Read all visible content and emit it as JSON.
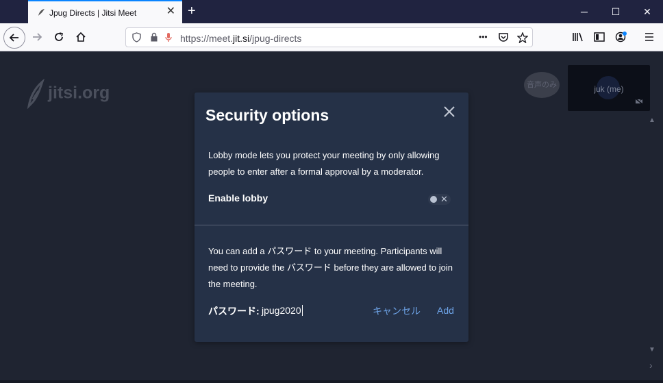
{
  "browser": {
    "tab_title": "Jpug Directs | Jitsi Meet",
    "url_prefix": "https://meet.",
    "url_host": "jit.si",
    "url_path": "/jpug-directs",
    "url_more": "•••"
  },
  "page": {
    "logo_text": "jitsi.org",
    "audio_only_label": "音声のみ",
    "thumbnail_name": "juk (me)"
  },
  "dialog": {
    "title": "Security options",
    "lobby_description": "Lobby mode lets you protect your meeting by only allowing people to enter after a formal approval by a moderator.",
    "lobby_label": "Enable lobby",
    "lobby_enabled": false,
    "password_description": "You can add a パスワード to your meeting. Participants will need to provide the パスワード before they are allowed to join the meeting.",
    "password_label": "パスワード:",
    "password_value": "jpug2020",
    "cancel_label": "キャンセル",
    "add_label": "Add"
  }
}
